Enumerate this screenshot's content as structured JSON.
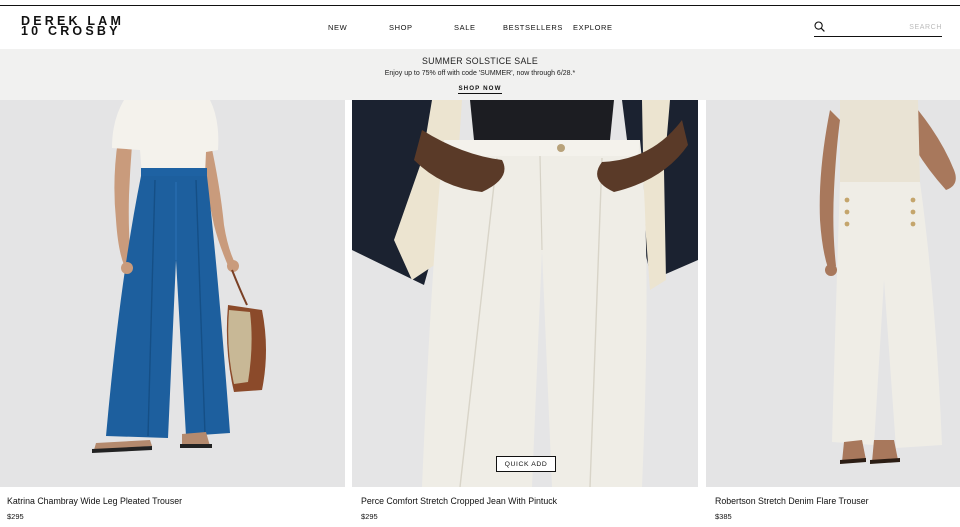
{
  "header": {
    "logo_line1": "DEREK LAM",
    "logo_line2": "10 CROSBY",
    "nav": [
      {
        "label": "NEW"
      },
      {
        "label": "SHOP"
      },
      {
        "label": "SALE"
      },
      {
        "label": "BESTSELLERS"
      },
      {
        "label": "EXPLORE"
      }
    ],
    "search": {
      "placeholder": "SEARCH",
      "value": "",
      "icon": "search-icon"
    }
  },
  "promo": {
    "title": "SUMMER SOLSTICE SALE",
    "subtitle": "Enjoy up to 75% off with code 'SUMMER', now through 6/28.*",
    "cta": "SHOP NOW"
  },
  "products": [
    {
      "name": "Katrina Chambray Wide Leg Pleated Trouser",
      "price": "$295",
      "image": "blue-wide-leg-trouser"
    },
    {
      "name": "Perce Comfort Stretch Cropped Jean With Pintuck",
      "price": "$295",
      "image": "white-cropped-jean",
      "quick_add": "QUICK ADD"
    },
    {
      "name": "Robertson Stretch Denim Flare Trouser",
      "price": "$385",
      "image": "white-flare-trouser"
    }
  ],
  "colors": {
    "promo_bg": "#f1f1f0",
    "image_bg": "#e3e3e4",
    "blue_denim": "#1d5f9e",
    "ivory": "#efede6",
    "navy": "#1b2230"
  }
}
